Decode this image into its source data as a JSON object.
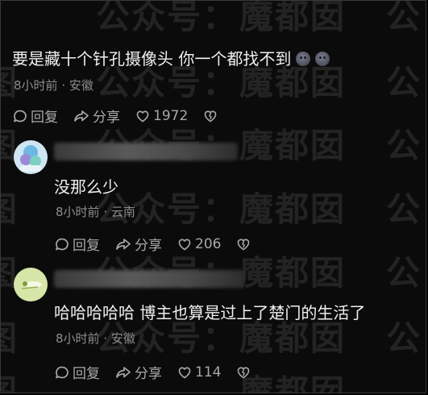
{
  "watermark": {
    "text": "公众号：魔都囡",
    "fragments": [
      "公众号：",
      "魔都囡",
      "公",
      "图",
      "魔都",
      "公众号",
      "魔都囡",
      "公",
      "图"
    ]
  },
  "comments": [
    {
      "text": "要是藏十个针孔摄像头 你一个都找不到",
      "emojis": [
        "sad-face-emoji",
        "sad-face-emoji"
      ],
      "time": "8小时前",
      "location": "安徽",
      "reply_label": "回复",
      "share_label": "分享",
      "likes": "1972"
    },
    {
      "text": "没那么少",
      "time": "8小时前",
      "location": "云南",
      "reply_label": "回复",
      "share_label": "分享",
      "likes": "206"
    },
    {
      "text": "哈哈哈哈哈 博主也算是过上了楚门的生活了",
      "time": "8小时前",
      "location": "安徽",
      "reply_label": "回复",
      "share_label": "分享",
      "likes": "114"
    }
  ],
  "meta_separator": "·",
  "colors": {
    "background": "#0b0b0b",
    "text": "#f0f0f0",
    "meta": "#8d8d8d",
    "action": "#a8a8a8"
  }
}
